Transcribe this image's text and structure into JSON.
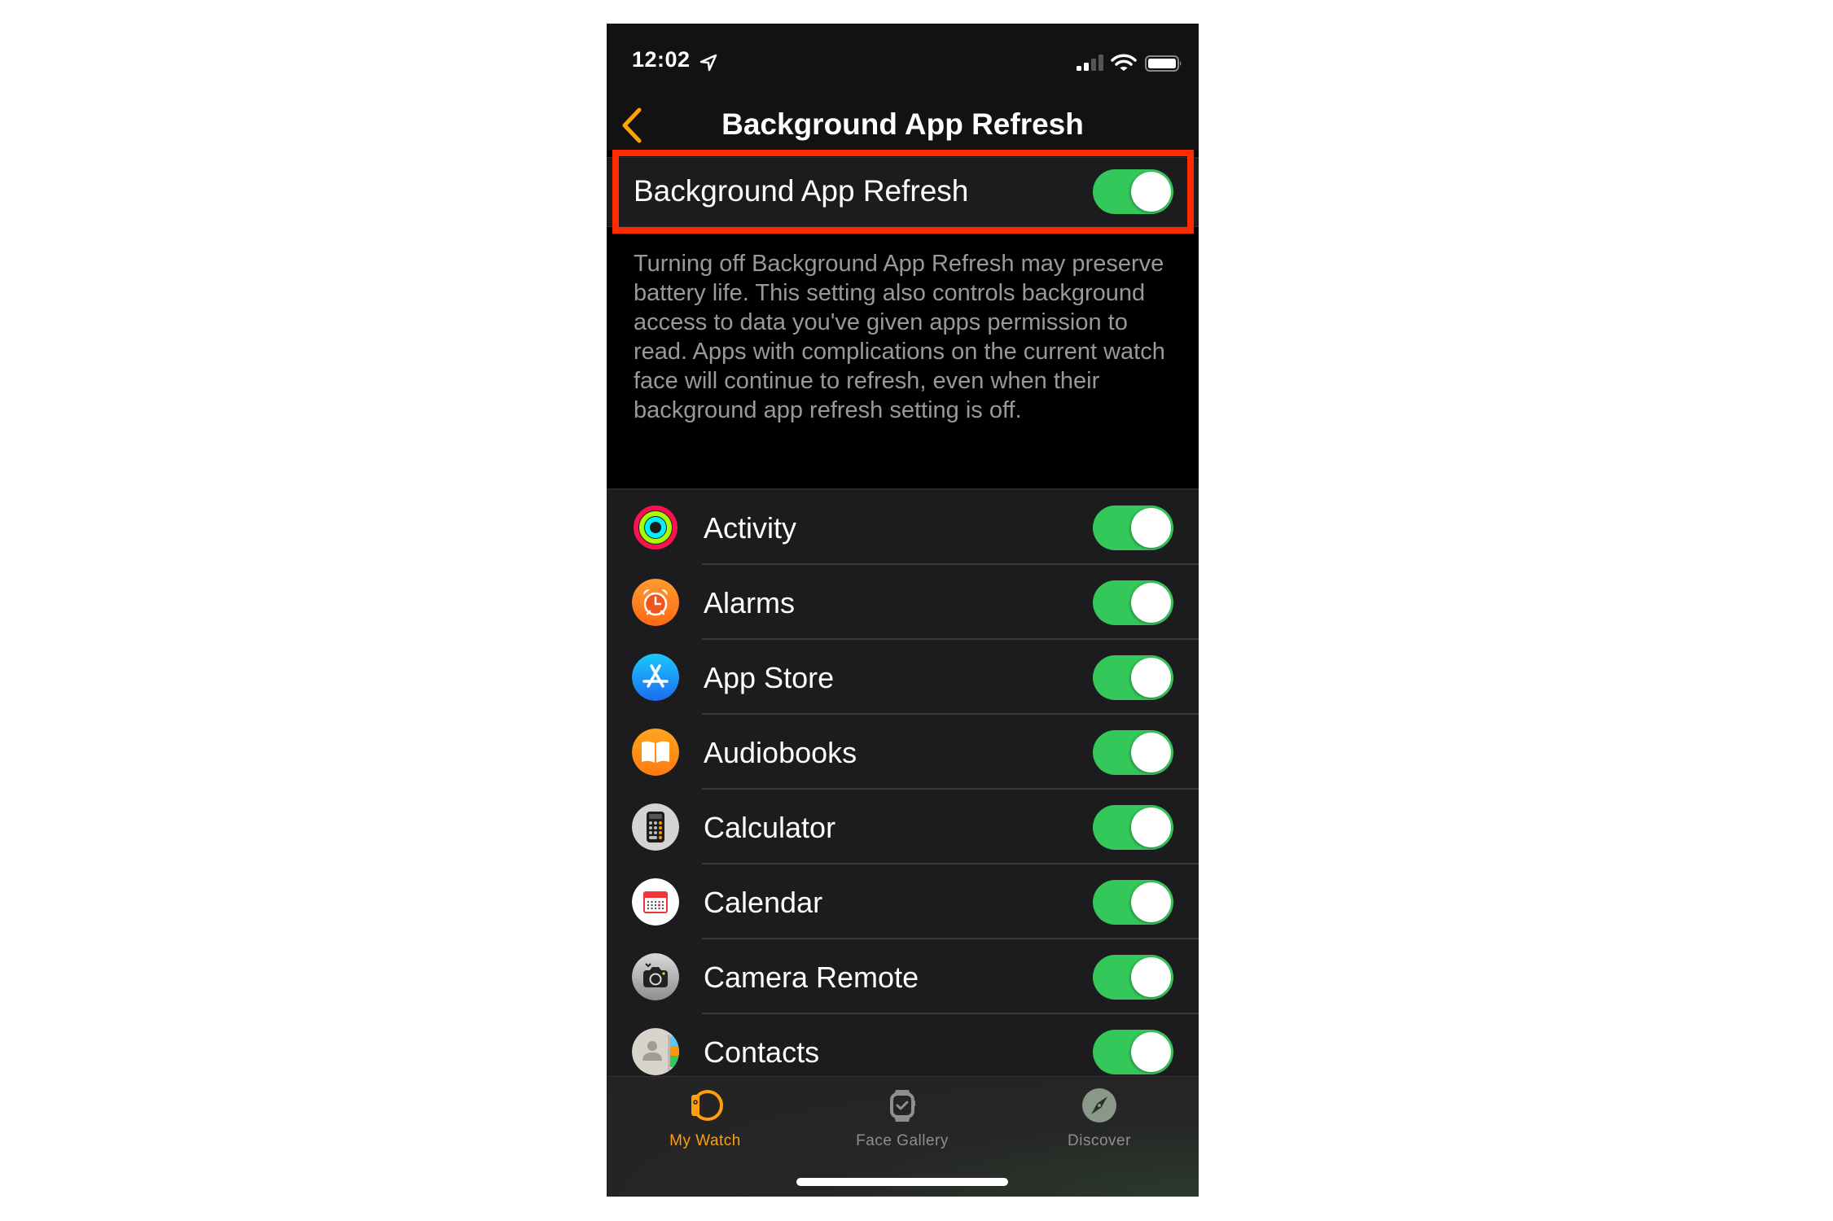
{
  "status_bar": {
    "time": "12:02",
    "location_icon": "location-arrow-icon",
    "signal_bars_active": 2,
    "signal_bars_total": 4,
    "wifi_icon": "wifi-icon",
    "battery_icon": "battery-icon"
  },
  "nav": {
    "back_icon": "chevron-left-icon",
    "title": "Background App Refresh"
  },
  "master": {
    "label": "Background App Refresh",
    "enabled": true,
    "highlight_color": "#ff2a00"
  },
  "description": "Turning off Background App Refresh may preserve battery life. This setting also controls background access to data you've given apps permission to read. Apps with complications on the current watch face will continue to refresh, even when their background app refresh setting is off.",
  "apps": [
    {
      "label": "Activity",
      "icon": "activity-rings-icon",
      "enabled": true
    },
    {
      "label": "Alarms",
      "icon": "alarm-clock-icon",
      "enabled": true
    },
    {
      "label": "App Store",
      "icon": "app-store-icon",
      "enabled": true
    },
    {
      "label": "Audiobooks",
      "icon": "open-book-icon",
      "enabled": true
    },
    {
      "label": "Calculator",
      "icon": "calculator-icon",
      "enabled": true
    },
    {
      "label": "Calendar",
      "icon": "calendar-icon",
      "enabled": true
    },
    {
      "label": "Camera Remote",
      "icon": "camera-icon",
      "enabled": true
    },
    {
      "label": "Contacts",
      "icon": "contacts-icon",
      "enabled": true
    }
  ],
  "tabs": [
    {
      "label": "My Watch",
      "icon": "watch-side-icon",
      "active": true
    },
    {
      "label": "Face Gallery",
      "icon": "watch-face-icon",
      "active": false
    },
    {
      "label": "Discover",
      "icon": "compass-icon",
      "active": false
    }
  ],
  "colors": {
    "accent": "#ff9f0a",
    "toggle_on": "#34c759",
    "inactive_tab": "#8e8e93"
  }
}
